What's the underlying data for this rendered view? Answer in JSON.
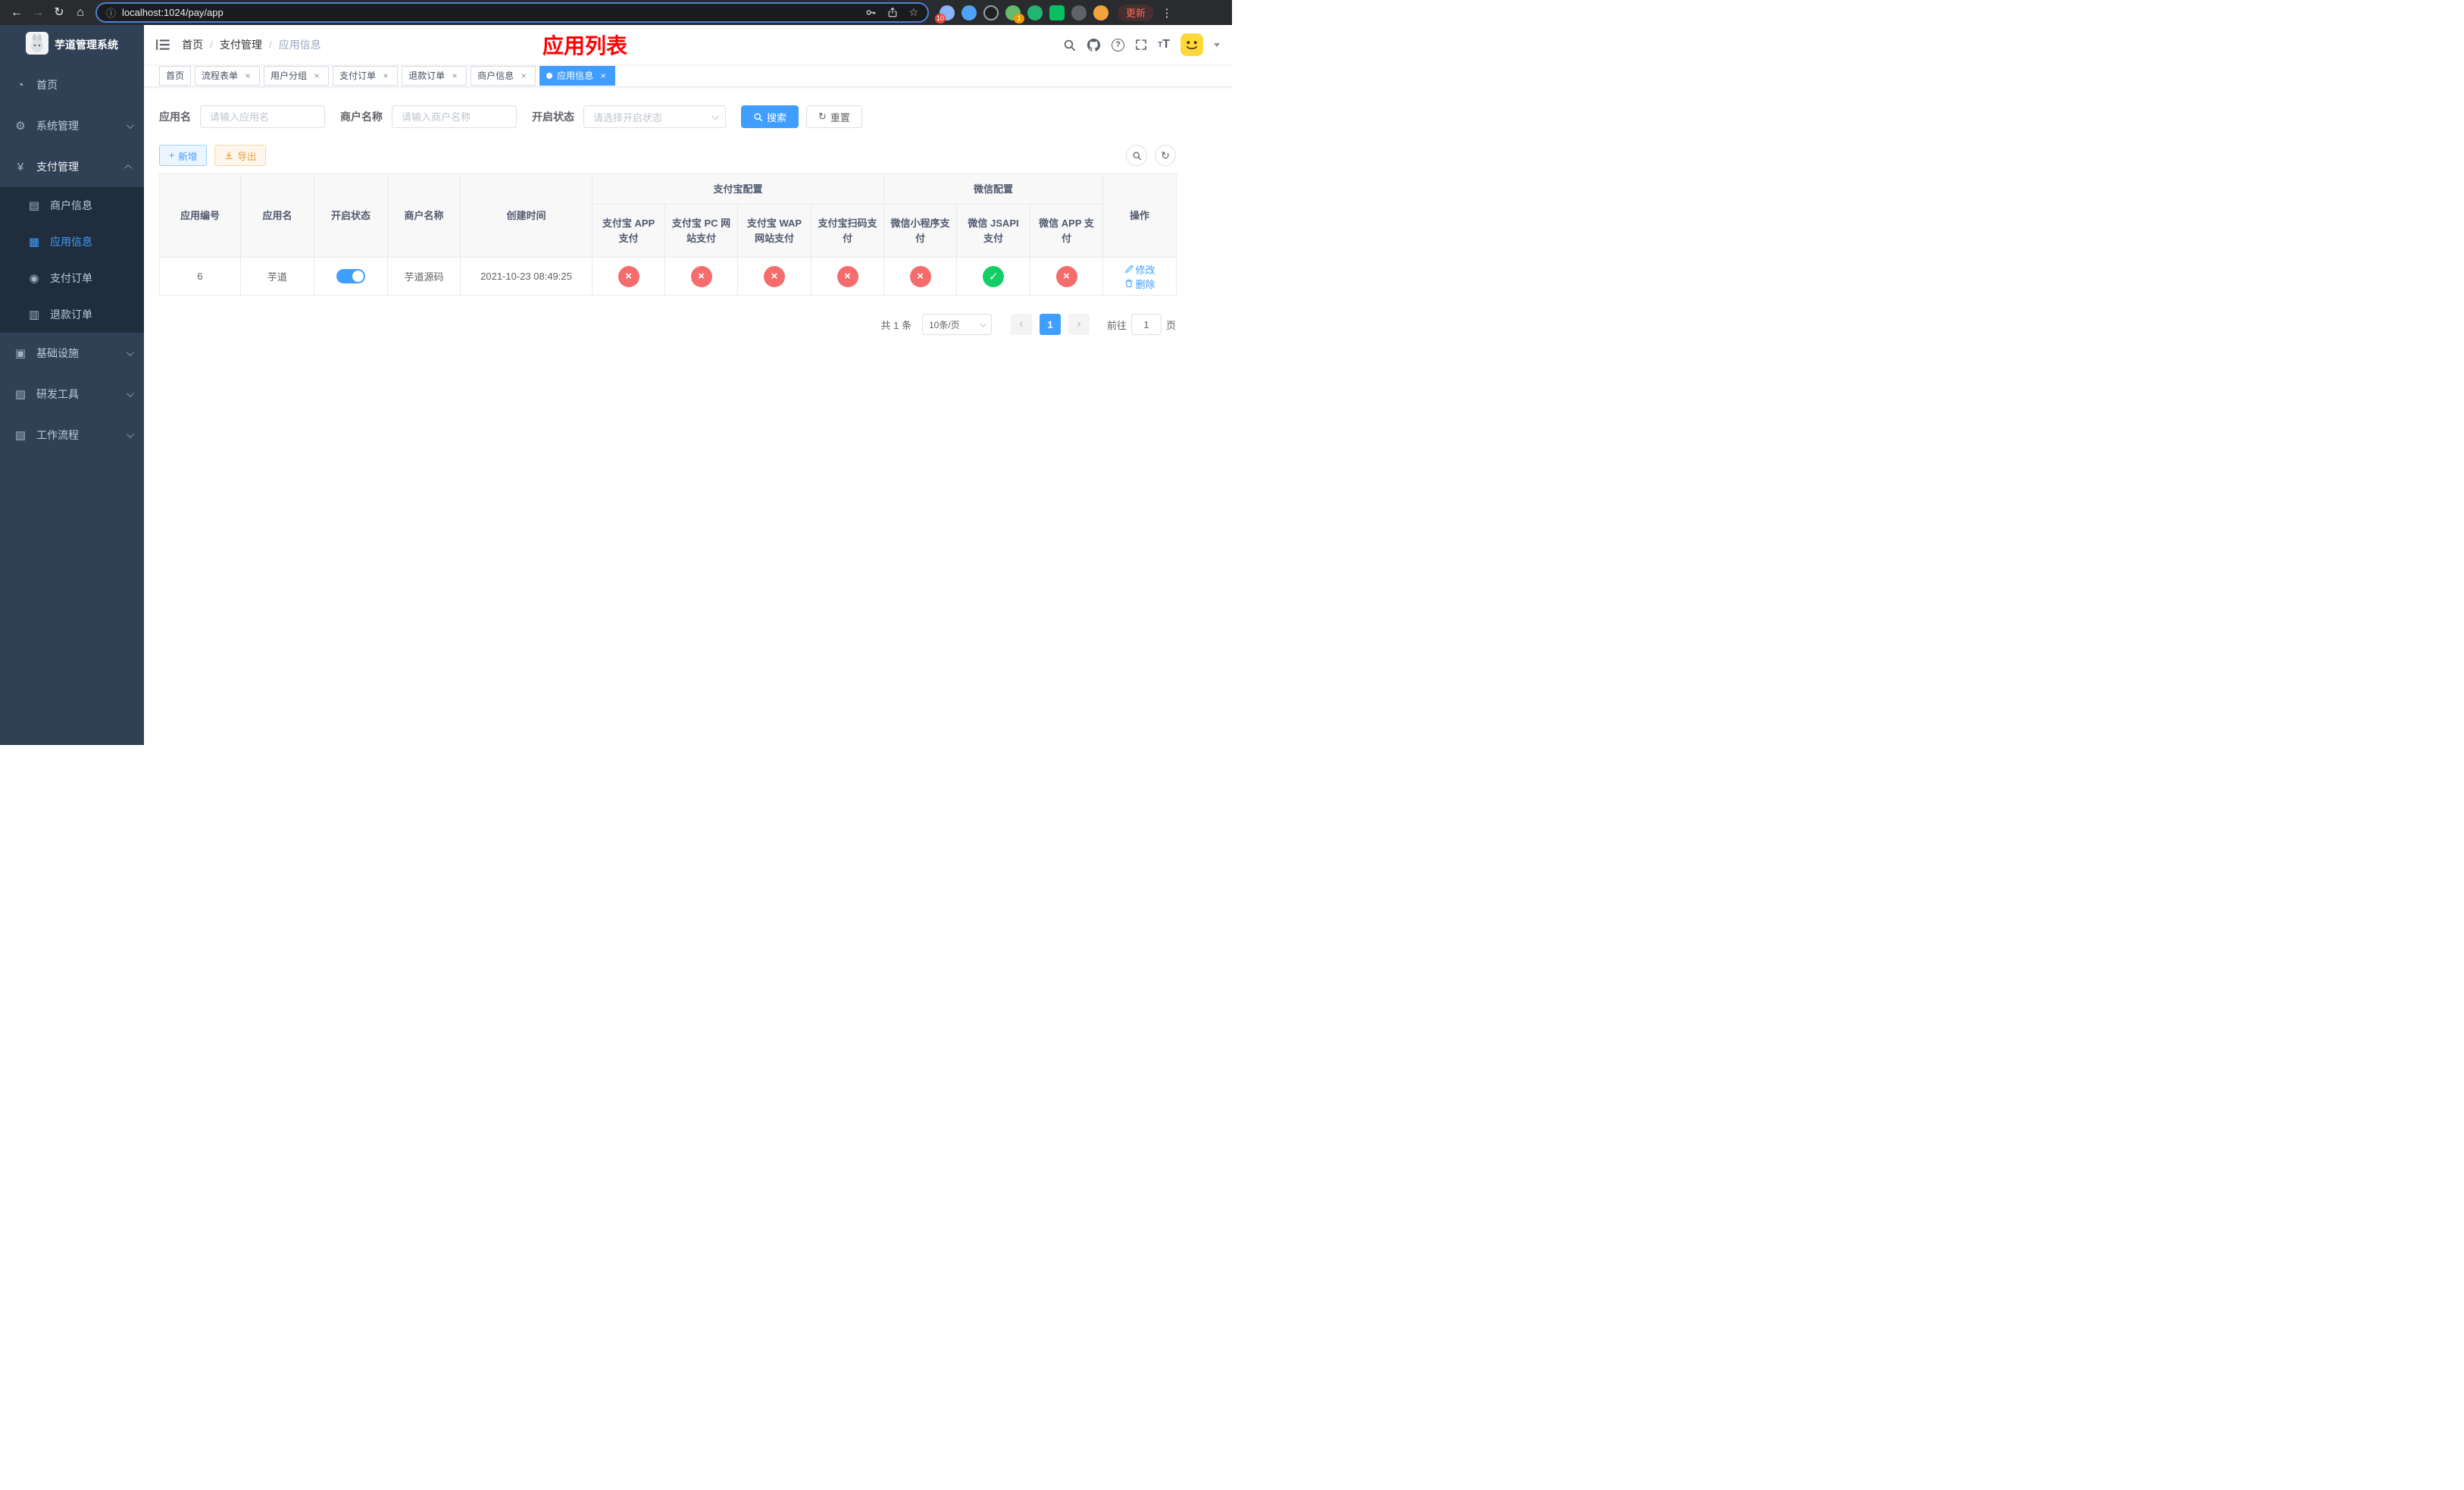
{
  "colors": {
    "accent": "#409eff",
    "success": "#13ce66",
    "danger": "#f56c6c",
    "warning": "#e6a23c",
    "sidebar_bg": "#304156",
    "submenu_bg": "#1f2d3d",
    "page_title_red": "#ff0000"
  },
  "icons": {
    "back": "←",
    "forward": "→",
    "reload": "↻",
    "home": "⌂",
    "site_info": "ⓘ",
    "star": "☆",
    "kebab": "⋮",
    "dashboard": "◔",
    "gear": "⚙",
    "yen": "¥",
    "merchant": "▤",
    "app": "▦",
    "order": "◉",
    "refund": "▥",
    "infra": "▣",
    "tools": "▨",
    "workflow": "▧",
    "reset": "↻",
    "refresh": "↻",
    "plus": "+",
    "prev": "‹",
    "next": "›",
    "check": "✓",
    "cross": "×",
    "close": "×"
  },
  "browser": {
    "url": "localhost:1024/pay/app",
    "update_label": "更新",
    "extension_badge_1": "10",
    "extension_badge_2": "1"
  },
  "sidebar": {
    "app_title": "芋道管理系统",
    "menu": [
      {
        "label": "首页"
      },
      {
        "label": "系统管理"
      },
      {
        "label": "支付管理"
      },
      {
        "label": "基础设施"
      },
      {
        "label": "研发工具"
      },
      {
        "label": "工作流程"
      }
    ],
    "payment_children": [
      {
        "label": "商户信息"
      },
      {
        "label": "应用信息"
      },
      {
        "label": "支付订单"
      },
      {
        "label": "退款订单"
      }
    ]
  },
  "navbar": {
    "breadcrumb": [
      {
        "label": "首页"
      },
      {
        "label": "支付管理"
      },
      {
        "label": "应用信息"
      }
    ],
    "page_title": "应用列表"
  },
  "tabs": [
    {
      "label": "首页",
      "closable": false,
      "active": false
    },
    {
      "label": "流程表单",
      "closable": true,
      "active": false
    },
    {
      "label": "用户分组",
      "closable": true,
      "active": false
    },
    {
      "label": "支付订单",
      "closable": true,
      "active": false
    },
    {
      "label": "退款订单",
      "closable": true,
      "active": false
    },
    {
      "label": "商户信息",
      "closable": true,
      "active": false
    },
    {
      "label": "应用信息",
      "closable": true,
      "active": true
    }
  ],
  "filters": {
    "app_name_label": "应用名",
    "app_name_placeholder": "请输入应用名",
    "merchant_label": "商户名称",
    "merchant_placeholder": "请输入商户名称",
    "status_label": "开启状态",
    "status_placeholder": "请选择开启状态",
    "search_label": "搜索",
    "reset_label": "重置"
  },
  "toolbar": {
    "add_label": "新增",
    "export_label": "导出"
  },
  "table": {
    "group_headers": {
      "alipay": "支付宝配置",
      "wechat": "微信配置"
    },
    "headers": {
      "app_id": "应用编号",
      "app_name": "应用名",
      "status": "开启状态",
      "merchant_name": "商户名称",
      "create_time": "创建时间",
      "alipay_app": "支付宝 APP 支付",
      "alipay_pc": "支付宝 PC 网站支付",
      "alipay_wap": "支付宝 WAP 网站支付",
      "alipay_qr": "支付宝扫码支付",
      "wechat_lite": "微信小程序支付",
      "wechat_jsapi": "微信 JSAPI 支付",
      "wechat_app": "微信 APP 支付",
      "actions": "操作"
    },
    "row": {
      "app_id": "6",
      "app_name": "芋道",
      "status_on": true,
      "merchant_name": "芋道源码",
      "create_time": "2021-10-23 08:49:25",
      "configs": {
        "alipay_app": false,
        "alipay_pc": false,
        "alipay_wap": false,
        "alipay_qr": false,
        "wechat_lite": false,
        "wechat_jsapi": true,
        "wechat_app": false
      },
      "edit_label": "修改",
      "delete_label": "删除"
    }
  },
  "pagination": {
    "total_text": "共 1 条",
    "page_size": "10条/页",
    "current_page": "1",
    "goto_label": "前往",
    "goto_value": "1",
    "page_unit": "页"
  }
}
